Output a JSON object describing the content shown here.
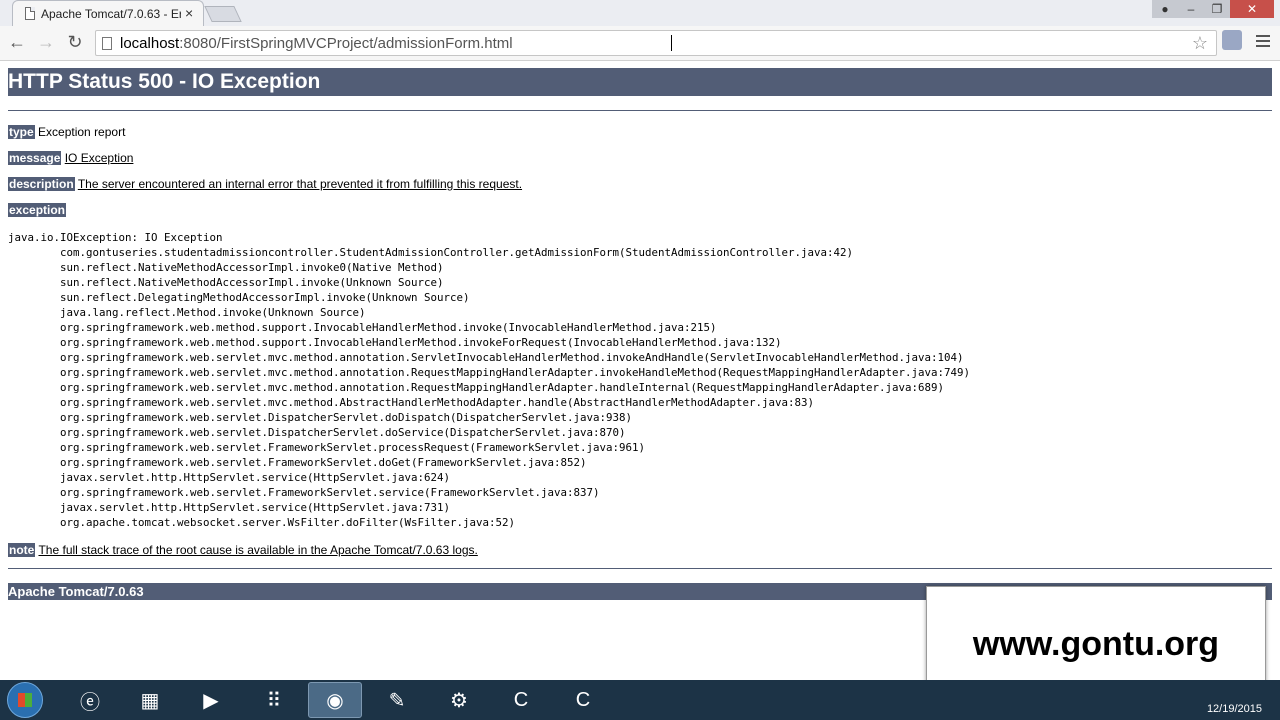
{
  "browser": {
    "tab_title": "Apache Tomcat/7.0.63 - Er",
    "tab_close": "×",
    "url_host": "localhost",
    "url_rest": ":8080/FirstSpringMVCProject/admissionForm.html"
  },
  "page": {
    "status_title": "HTTP Status 500 - IO Exception",
    "type_label": "type",
    "type_value": "Exception report",
    "message_label": "message",
    "message_value": "IO Exception",
    "description_label": "description",
    "description_value": "The server encountered an internal error that prevented it from fulfilling this request.",
    "exception_label": "exception",
    "stack_trace": "java.io.IOException: IO Exception\n\tcom.gontuseries.studentadmissioncontroller.StudentAdmissionController.getAdmissionForm(StudentAdmissionController.java:42)\n\tsun.reflect.NativeMethodAccessorImpl.invoke0(Native Method)\n\tsun.reflect.NativeMethodAccessorImpl.invoke(Unknown Source)\n\tsun.reflect.DelegatingMethodAccessorImpl.invoke(Unknown Source)\n\tjava.lang.reflect.Method.invoke(Unknown Source)\n\torg.springframework.web.method.support.InvocableHandlerMethod.invoke(InvocableHandlerMethod.java:215)\n\torg.springframework.web.method.support.InvocableHandlerMethod.invokeForRequest(InvocableHandlerMethod.java:132)\n\torg.springframework.web.servlet.mvc.method.annotation.ServletInvocableHandlerMethod.invokeAndHandle(ServletInvocableHandlerMethod.java:104)\n\torg.springframework.web.servlet.mvc.method.annotation.RequestMappingHandlerAdapter.invokeHandleMethod(RequestMappingHandlerAdapter.java:749)\n\torg.springframework.web.servlet.mvc.method.annotation.RequestMappingHandlerAdapter.handleInternal(RequestMappingHandlerAdapter.java:689)\n\torg.springframework.web.servlet.mvc.method.AbstractHandlerMethodAdapter.handle(AbstractHandlerMethodAdapter.java:83)\n\torg.springframework.web.servlet.DispatcherServlet.doDispatch(DispatcherServlet.java:938)\n\torg.springframework.web.servlet.DispatcherServlet.doService(DispatcherServlet.java:870)\n\torg.springframework.web.servlet.FrameworkServlet.processRequest(FrameworkServlet.java:961)\n\torg.springframework.web.servlet.FrameworkServlet.doGet(FrameworkServlet.java:852)\n\tjavax.servlet.http.HttpServlet.service(HttpServlet.java:624)\n\torg.springframework.web.servlet.FrameworkServlet.service(FrameworkServlet.java:837)\n\tjavax.servlet.http.HttpServlet.service(HttpServlet.java:731)\n\torg.apache.tomcat.websocket.server.WsFilter.doFilter(WsFilter.java:52)",
    "note_label": "note",
    "note_value": "The full stack trace of the root cause is available in the Apache Tomcat/7.0.63 logs.",
    "footer": "Apache Tomcat/7.0.63"
  },
  "watermark": "www.gontu.org",
  "taskbar": {
    "clock_date": "12/19/2015",
    "items": [
      "start-orb",
      "internet-explorer-icon",
      "file-explorer-icon",
      "media-player-icon",
      "apps-icon",
      "chrome-icon",
      "notepad-icon",
      "java-ee-ide-icon",
      "camtasia-icon",
      "camtasia-recorder-icon"
    ]
  },
  "colors": {
    "header_bg": "#525d76",
    "page_bg": "#ffffff",
    "taskbar_bg": "#1c3346"
  }
}
